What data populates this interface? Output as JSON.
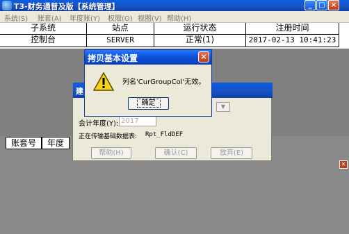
{
  "window": {
    "title": "T3-财务通普及版【系统管理】"
  },
  "caption_buttons": {
    "minimize": "_",
    "maximize": "□",
    "close": "×"
  },
  "menubar": {
    "items": [
      "系统(S)",
      "账套(A)",
      "年度账(Y)",
      "权限(O)",
      "视图(V)",
      "帮助(H)"
    ]
  },
  "table": {
    "headers": [
      "子系统",
      "站点",
      "运行状态",
      "注册时间"
    ],
    "row": [
      "控制台",
      "SERVER",
      "正常(1)",
      "2017-02-13 10:41:23"
    ]
  },
  "lower_table": {
    "headers": [
      "账套号",
      "年度"
    ]
  },
  "back_dialog": {
    "title_fragment": "建",
    "year_label": "会计年度(Y):",
    "year_value": "2017",
    "transfer_label": "正在传输基础数据表:",
    "transfer_value": "Rpt_FldDEF",
    "buttons": {
      "help": "帮助(H)",
      "confirm": "确认(C)",
      "cancel": "放弃(E)"
    }
  },
  "modal": {
    "title": "拷贝基本设置",
    "message": "列名'CurGroupCol'无效。",
    "ok_label": "确定",
    "icon": "warning-icon"
  },
  "colors": {
    "titlebar": "#1a52c4",
    "workspace": "#808080",
    "dialog": "#ece9d8"
  }
}
